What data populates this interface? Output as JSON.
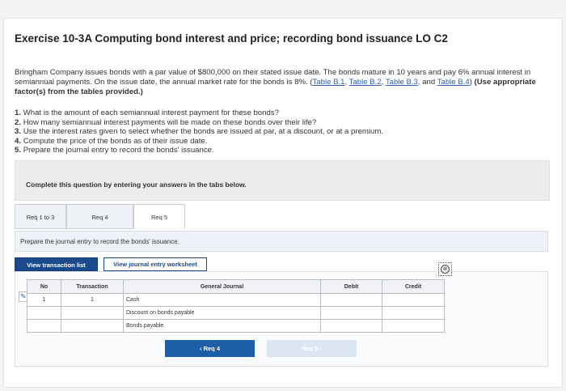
{
  "header": {
    "title": "Exercise 10-3A Computing bond interest and price; recording bond issuance LO C2"
  },
  "intro": {
    "text_1": "Bringham Company issues bonds with a par value of $800,000 on their stated issue date. The bonds mature in 10 years and pay 6% annual interest in semiannual payments. On the issue date, the annual market rate for the bonds is 8%. (",
    "link_b1": "Table B.1",
    "sep_1": ", ",
    "link_b2": "Table B.2",
    "sep_2": ", ",
    "link_b3": "Table B.3",
    "sep_3": ", and ",
    "link_b4": "Table B.4",
    "text_2": ")",
    "note": " (Use appropriate factor(s) from the tables provided.)"
  },
  "questions": [
    {
      "num": "1.",
      "text": "What is the amount of each semiannual interest payment for these bonds?"
    },
    {
      "num": "2.",
      "text": "How many semiannual interest payments will be made on these bonds over their life?"
    },
    {
      "num": "3.",
      "text": "Use the interest rates given to select whether the bonds are issued at par, at a discount, or at a premium."
    },
    {
      "num": "4.",
      "text": "Compute the price of the bonds as of their issue date."
    },
    {
      "num": "5.",
      "text": "Prepare the journal entry to record the bonds' issuance."
    }
  ],
  "panel": {
    "text": "Complete this question by entering your answers in the tabs below."
  },
  "tabs": [
    {
      "label": "Req 1 to 3"
    },
    {
      "label": "Req 4"
    },
    {
      "label": "Req 5"
    }
  ],
  "instruction": "Prepare the journal entry to record the bonds' issuance.",
  "buttons": {
    "view_transaction_list": "View transaction list",
    "view_journal_worksheet": "View journal entry worksheet"
  },
  "close_symbol": "⊗",
  "journal": {
    "headers": {
      "no": "No",
      "transaction": "Transaction",
      "general_journal": "General Journal",
      "debit": "Debit",
      "credit": "Credit"
    },
    "rows": [
      {
        "no": "1",
        "transaction": "1",
        "account": "Cash",
        "debit": "",
        "credit": ""
      },
      {
        "no": "",
        "transaction": "",
        "account": "Discount on bonds payable",
        "debit": "",
        "credit": ""
      },
      {
        "no": "",
        "transaction": "",
        "account": "Bonds payable",
        "debit": "",
        "credit": ""
      }
    ]
  },
  "nav": {
    "prev_label": "‹  Req 4",
    "next_label": "Req 5  ›"
  },
  "colors": {
    "button_dark": "#1a4a8c",
    "nav_active": "#1c5ea8",
    "nav_disabled": "#dbe6f2",
    "link": "#2a62b0"
  }
}
